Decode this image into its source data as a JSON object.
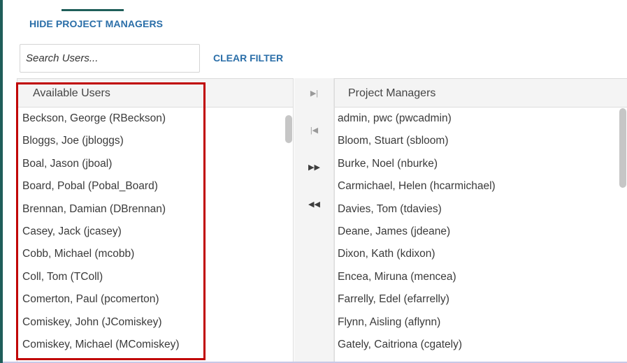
{
  "toolbar": {
    "hide_label": "HIDE PROJECT MANAGERS",
    "clear_label": "CLEAR FILTER"
  },
  "search": {
    "placeholder": "Search Users..."
  },
  "available": {
    "header": "Available Users",
    "items": [
      "Beckson, George (RBeckson)",
      "Bloggs, Joe (jbloggs)",
      "Boal, Jason (jboal)",
      "Board, Pobal (Pobal_Board)",
      "Brennan, Damian (DBrennan)",
      "Casey, Jack (jcasey)",
      "Cobb, Michael (mcobb)",
      "Coll, Tom (TColl)",
      "Comerton, Paul (pcomerton)",
      "Comiskey, John (JComiskey)",
      "Comiskey, Michael (MComiskey)"
    ]
  },
  "managers": {
    "header": "Project Managers",
    "items": [
      "admin, pwc (pwcadmin)",
      "Bloom, Stuart (sbloom)",
      "Burke, Noel (nburke)",
      "Carmichael, Helen (hcarmichael)",
      "Davies, Tom (tdavies)",
      "Deane, James (jdeane)",
      "Dixon, Kath (kdixon)",
      "Encea, Miruna (mencea)",
      "Farrelly, Edel (efarrelly)",
      "Flynn, Aisling (aflynn)",
      "Gately, Caitriona (cgately)"
    ]
  },
  "controls": {
    "move_right_icon": "▶|",
    "move_left_icon": "|◀",
    "move_all_right_icon": "▶▶",
    "move_all_left_icon": "◀◀"
  },
  "colors": {
    "accent": "#1f5e5a",
    "link": "#2a6ea8",
    "highlight": "#c00000"
  }
}
